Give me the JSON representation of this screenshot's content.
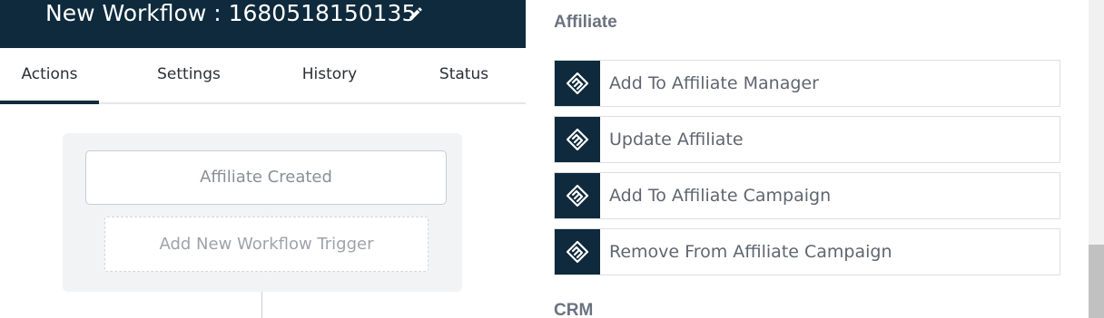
{
  "workflow": {
    "title": "New Workflow : 1680518150135"
  },
  "tabs": [
    {
      "label": "Actions",
      "active": true
    },
    {
      "label": "Settings",
      "active": false
    },
    {
      "label": "History",
      "active": false
    },
    {
      "label": "Status",
      "active": false
    }
  ],
  "canvas": {
    "trigger_label": "Affiliate Created",
    "add_trigger_label": "Add New Workflow Trigger"
  },
  "panel": {
    "sections": [
      {
        "title": "Affiliate",
        "actions": [
          {
            "label": "Add To Affiliate Manager",
            "icon": "handshake-icon"
          },
          {
            "label": "Update Affiliate",
            "icon": "handshake-icon"
          },
          {
            "label": "Add To Affiliate Campaign",
            "icon": "handshake-icon"
          },
          {
            "label": "Remove From Affiliate Campaign",
            "icon": "handshake-icon"
          }
        ]
      },
      {
        "title": "CRM",
        "actions": []
      }
    ]
  },
  "colors": {
    "header_bg": "#0e2a3c",
    "icon_bg": "#0e2a3c",
    "section_title": "#6b7280"
  }
}
